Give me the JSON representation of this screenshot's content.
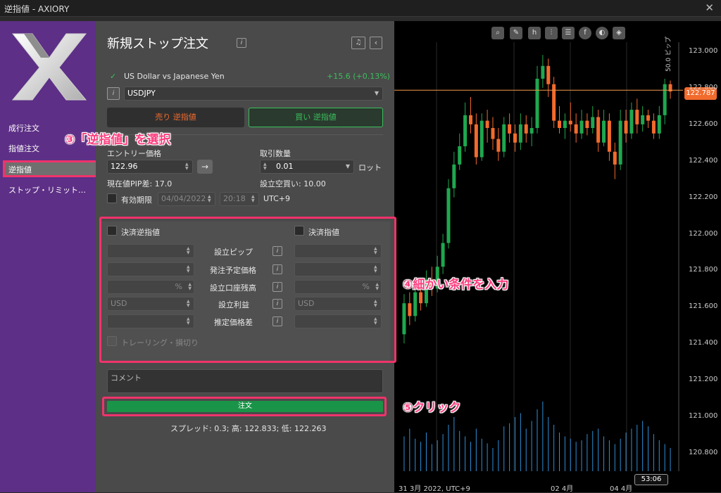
{
  "window": {
    "title": "逆指値 - AXIORY"
  },
  "sidebar": {
    "items": [
      "成行注文",
      "指値注文",
      "逆指値",
      "ストップ・リミット…"
    ]
  },
  "panel": {
    "title": "新規ストップ注文",
    "symbol_name": "US Dollar vs Japanese Yen",
    "change": "+15.6 (+0.13%)",
    "symbol": "USDJPY",
    "sell_label": "売り 逆指値",
    "buy_label": "買い 逆指値",
    "entry_label": "エントリー価格",
    "entry_value": "122.96",
    "qty_label": "取引数量",
    "qty_value": "0.01",
    "lot": "ロット",
    "pip_diff": "現在値PIP差: 17.0",
    "margin": "設立空買い: 10.00",
    "expiry_label": "有効期限",
    "expiry_date": "04/04/2022",
    "expiry_time": "20:18",
    "tz": "UTC+9",
    "sl_label": "決済逆指値",
    "tp_label": "決済指値",
    "row_labels": [
      "設立ピップ",
      "発注予定価格",
      "設立口座残高",
      "設立利益",
      "推定価格差"
    ],
    "pct": "%",
    "usd": "USD",
    "trailing": "トレーリング・損切り",
    "comment_placeholder": "コメント",
    "order_button": "注文",
    "spread": "スプレッド: 0.3; 高: 122.833; 低: 122.263"
  },
  "annotations": {
    "step3": "③「逆指値」を選択",
    "step4": "④細かい条件を入力",
    "step5": "⑤クリック"
  },
  "chart": {
    "current_price": "122.787",
    "pip_label": "50.0 ピップ",
    "timer": "53:06",
    "x_labels": [
      "31 3月 2022, UTC+9",
      "02 4月",
      "04 4月"
    ],
    "colors": {
      "up": "#1fa74f",
      "down": "#f26b2d",
      "volume": "#2f8fd8",
      "price_line": "#f2994a"
    }
  },
  "chart_data": {
    "type": "candlestick",
    "y_ticks": [
      "123.000",
      "122.800",
      "122.600",
      "122.400",
      "122.200",
      "122.000",
      "121.800",
      "121.600",
      "121.400",
      "121.200",
      "121.000",
      "120.800"
    ],
    "ylim": [
      120.7,
      123.05
    ],
    "candles": [
      [
        121.45,
        121.62,
        121.67,
        121.4
      ],
      [
        121.62,
        121.55,
        121.68,
        121.5
      ],
      [
        121.55,
        121.68,
        121.72,
        121.52
      ],
      [
        121.68,
        121.62,
        121.75,
        121.58
      ],
      [
        121.62,
        121.75,
        121.8,
        121.6
      ],
      [
        121.75,
        121.7,
        121.82,
        121.66
      ],
      [
        121.7,
        121.82,
        121.88,
        121.68
      ],
      [
        121.82,
        121.95,
        122.0,
        121.78
      ],
      [
        121.95,
        122.25,
        122.3,
        121.92
      ],
      [
        122.25,
        122.38,
        122.45,
        122.2
      ],
      [
        122.38,
        122.48,
        122.55,
        122.35
      ],
      [
        122.48,
        122.65,
        122.72,
        122.45
      ],
      [
        122.65,
        122.6,
        122.75,
        122.55
      ],
      [
        122.6,
        122.42,
        122.66,
        122.38
      ],
      [
        122.42,
        122.62,
        122.66,
        122.4
      ],
      [
        122.62,
        122.58,
        122.68,
        122.5
      ],
      [
        122.58,
        122.52,
        122.64,
        122.46
      ],
      [
        122.52,
        122.45,
        122.58,
        122.4
      ],
      [
        122.45,
        122.6,
        122.64,
        122.42
      ],
      [
        122.6,
        122.55,
        122.66,
        122.5
      ],
      [
        122.55,
        122.5,
        122.6,
        122.45
      ],
      [
        122.5,
        122.6,
        122.66,
        122.46
      ],
      [
        122.6,
        122.55,
        122.65,
        122.5
      ],
      [
        122.55,
        122.58,
        122.64,
        122.48
      ],
      [
        122.58,
        122.85,
        122.92,
        122.55
      ],
      [
        122.85,
        122.92,
        122.98,
        122.8
      ],
      [
        122.92,
        122.82,
        122.96,
        122.75
      ],
      [
        122.82,
        122.62,
        122.86,
        122.58
      ],
      [
        122.62,
        122.58,
        122.7,
        122.55
      ],
      [
        122.58,
        122.62,
        122.66,
        122.52
      ],
      [
        122.62,
        122.6,
        122.72,
        122.56
      ],
      [
        122.6,
        122.55,
        122.66,
        122.5
      ],
      [
        122.55,
        122.62,
        122.68,
        122.52
      ],
      [
        122.62,
        122.58,
        122.66,
        122.54
      ],
      [
        122.58,
        122.64,
        122.7,
        122.55
      ],
      [
        122.64,
        122.5,
        122.68,
        122.45
      ],
      [
        122.5,
        122.62,
        122.68,
        122.48
      ],
      [
        122.62,
        122.45,
        122.66,
        122.4
      ],
      [
        122.45,
        122.38,
        122.5,
        122.3
      ],
      [
        122.38,
        122.62,
        122.68,
        122.35
      ],
      [
        122.62,
        122.55,
        122.68,
        122.5
      ],
      [
        122.55,
        122.68,
        122.72,
        122.52
      ],
      [
        122.68,
        122.6,
        122.74,
        122.55
      ],
      [
        122.6,
        122.65,
        122.7,
        122.56
      ],
      [
        122.65,
        122.62,
        122.68,
        122.58
      ],
      [
        122.62,
        122.55,
        122.66,
        122.52
      ],
      [
        122.55,
        122.65,
        122.7,
        122.52
      ],
      [
        122.65,
        122.82,
        122.85,
        122.6
      ],
      [
        122.82,
        122.78,
        122.84,
        122.74
      ]
    ],
    "volume": [
      0.45,
      0.55,
      0.42,
      0.38,
      0.5,
      0.35,
      0.4,
      0.48,
      0.6,
      0.7,
      0.52,
      0.45,
      0.38,
      0.55,
      0.42,
      0.36,
      0.3,
      0.4,
      0.58,
      0.62,
      0.7,
      0.75,
      0.55,
      0.65,
      0.8,
      0.9,
      0.7,
      0.6,
      0.5,
      0.45,
      0.42,
      0.38,
      0.4,
      0.48,
      0.52,
      0.55,
      0.45,
      0.4,
      0.35,
      0.42,
      0.5,
      0.55,
      0.6,
      0.65,
      0.58,
      0.48,
      0.4,
      0.35,
      0.3
    ]
  }
}
